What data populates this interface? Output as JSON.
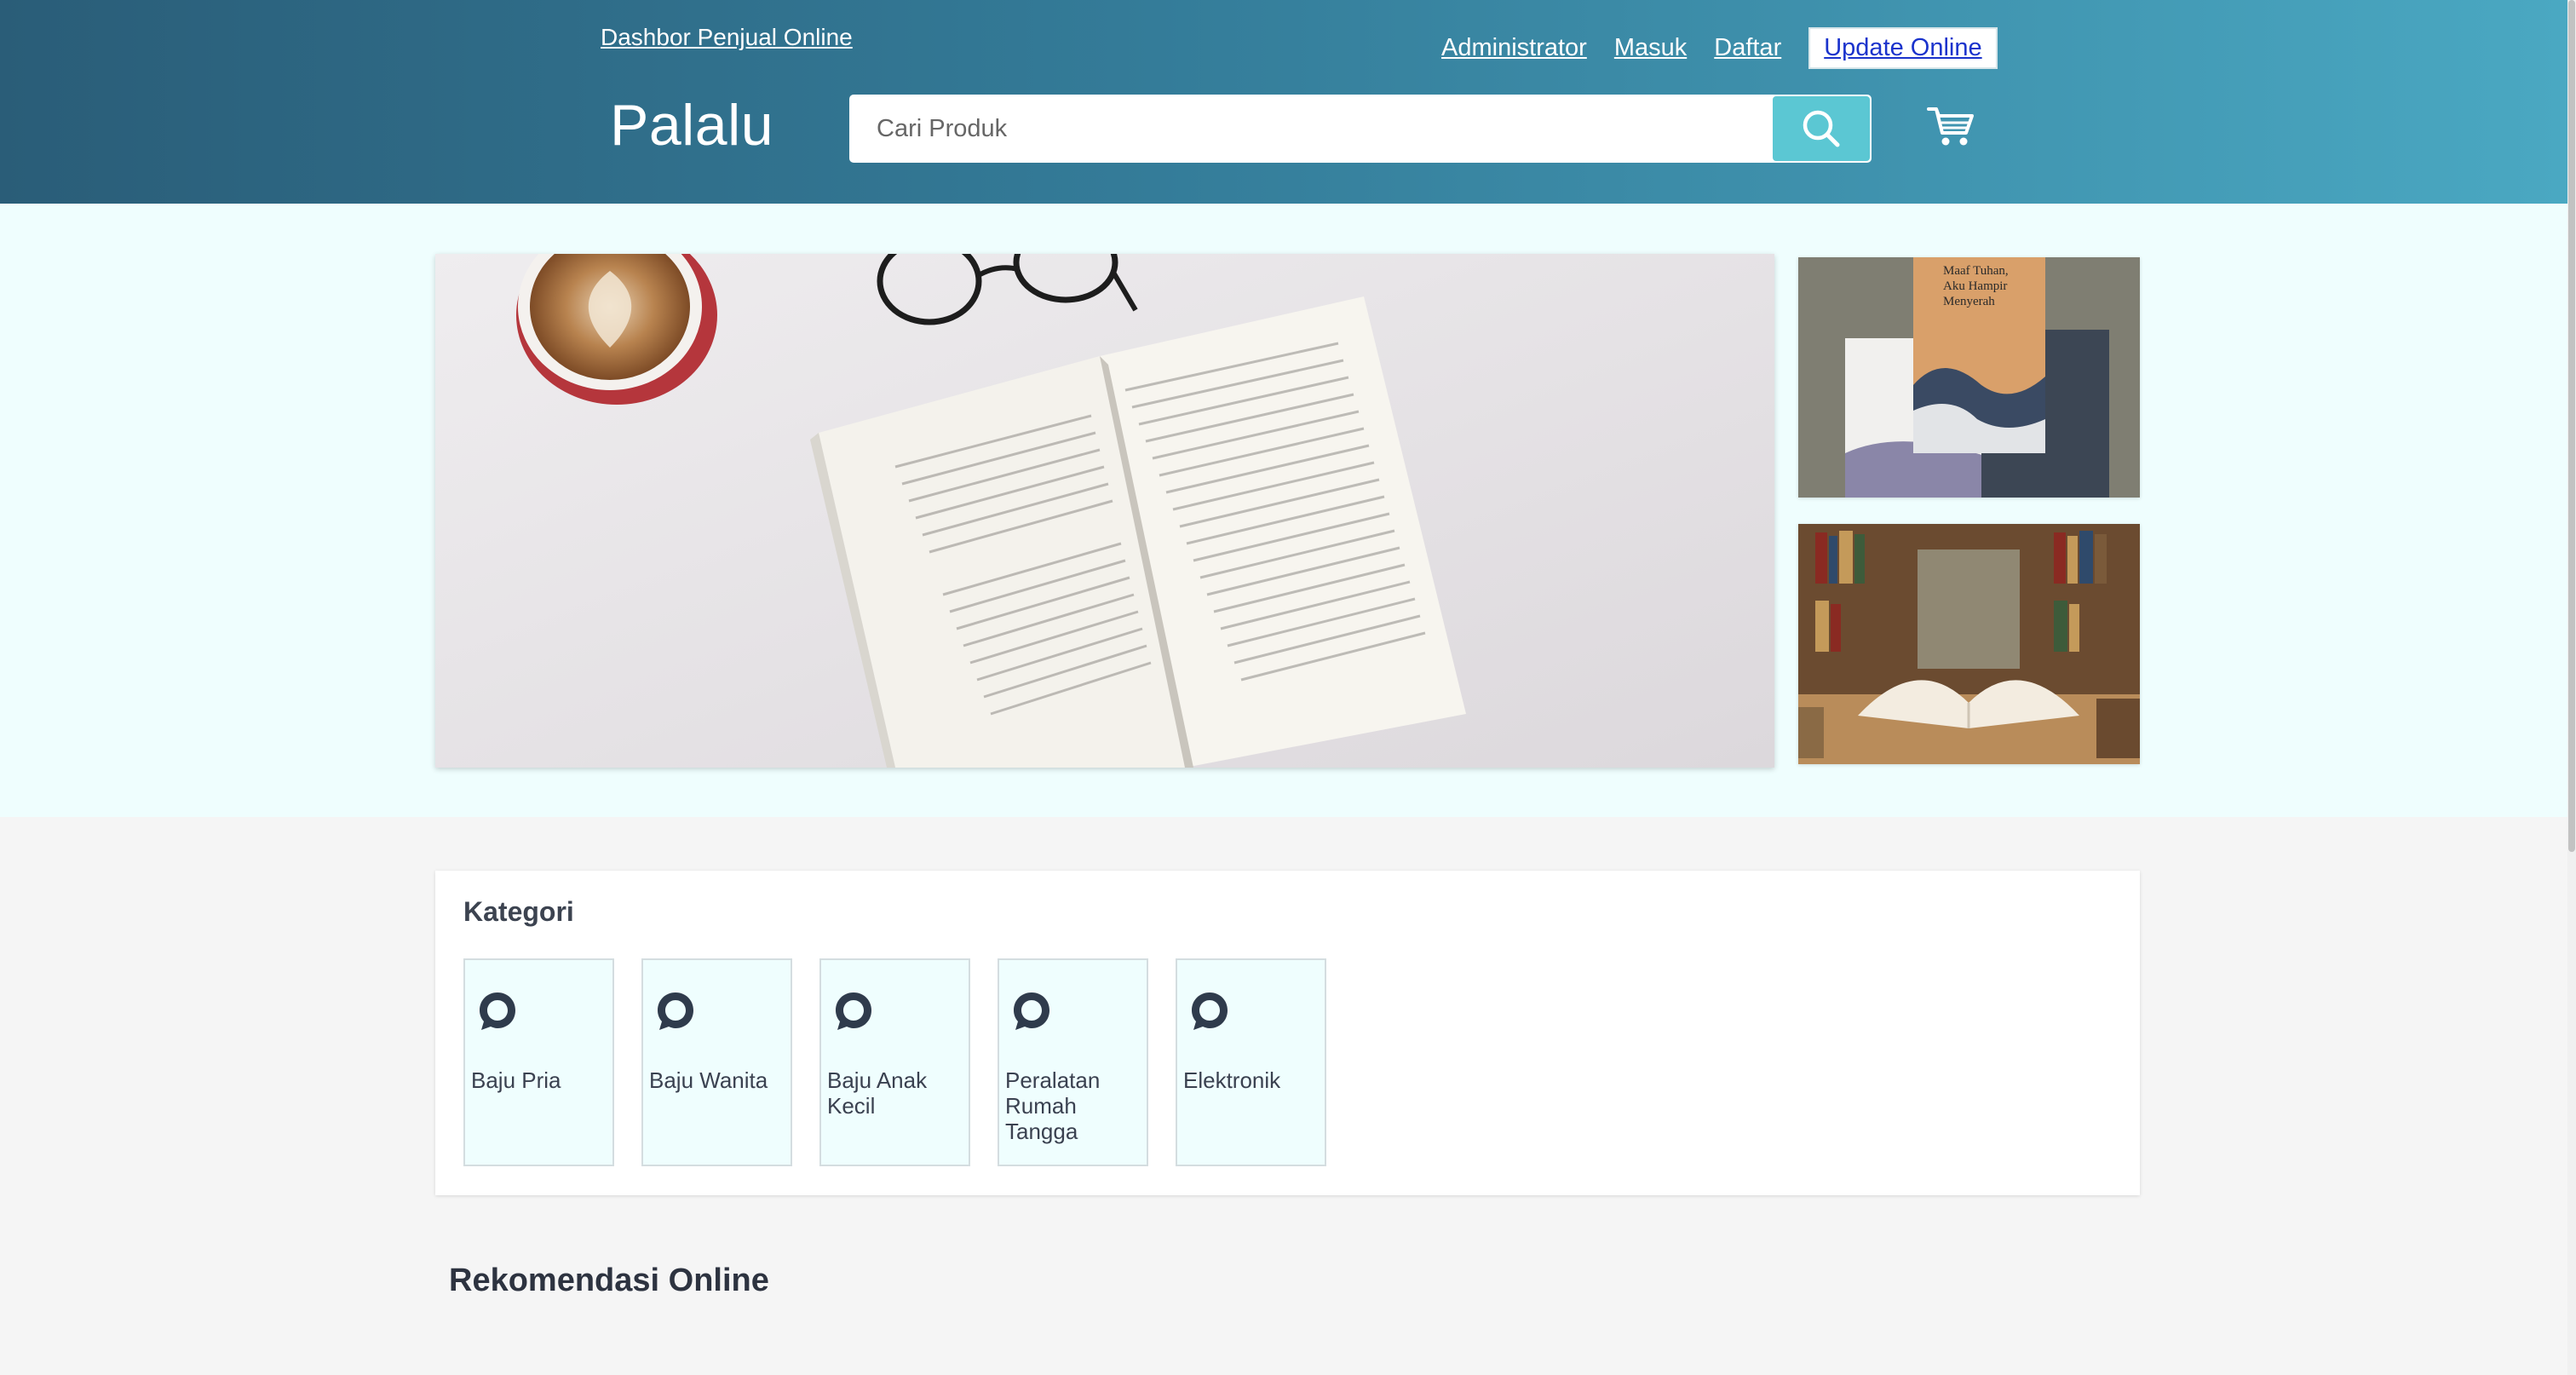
{
  "header": {
    "seller_dashboard_link": "Dashbor Penjual Online",
    "nav": {
      "admin": "Administrator",
      "login": "Masuk",
      "register": "Daftar",
      "update": "Update Online"
    },
    "brand": "Palalu",
    "search": {
      "placeholder": "Cari Produk"
    },
    "cart_icon": "cart-icon"
  },
  "hero": {
    "main_banner": "open book with coffee and glasses",
    "side_banners": [
      "stack of books",
      "open book in library"
    ]
  },
  "categories": {
    "title": "Kategori",
    "items": [
      {
        "label": "Baju Pria",
        "icon": "chat-bubble-icon"
      },
      {
        "label": "Baju Wanita",
        "icon": "chat-bubble-icon"
      },
      {
        "label": "Baju Anak Kecil",
        "icon": "chat-bubble-icon"
      },
      {
        "label": "Peralatan Rumah Tangga",
        "icon": "chat-bubble-icon"
      },
      {
        "label": "Elektronik",
        "icon": "chat-bubble-icon"
      }
    ]
  },
  "recommendations": {
    "title": "Rekomendasi Online"
  },
  "colors": {
    "header_start": "#2a5d78",
    "header_end": "#4aa8c2",
    "search_button": "#5bc7d3",
    "hero_bg": "#effefe",
    "page_bg": "#f5f5f5"
  }
}
